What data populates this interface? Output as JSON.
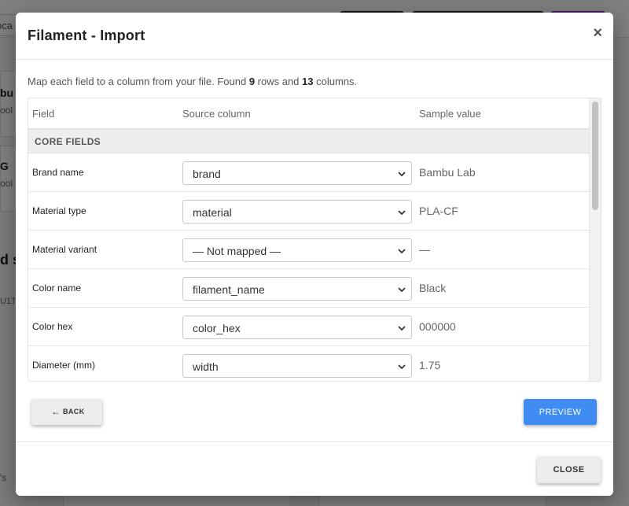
{
  "background": {
    "search_text": "oca",
    "card1_title": "bu",
    "card1_sub": "ool",
    "card2_title": "G",
    "card2_sub": "ool",
    "heading_fragment": "d s",
    "tag_fragment": "U1T",
    "bottom_fragment": "'s"
  },
  "modal": {
    "title": "Filament - Import",
    "close_symbol": "×",
    "intro_prefix": "Map each field to a column from your file. Found ",
    "rows_count": "9",
    "intro_mid": " rows and ",
    "columns_count": "13",
    "intro_suffix": " columns."
  },
  "table": {
    "headers": {
      "field": "Field",
      "source": "Source column",
      "sample": "Sample value"
    },
    "section": "CORE FIELDS",
    "rows": [
      {
        "field": "Brand name",
        "source": "brand",
        "sample": "Bambu Lab"
      },
      {
        "field": "Material type",
        "source": "material",
        "sample": "PLA-CF"
      },
      {
        "field": "Material variant",
        "source": "— Not mapped —",
        "sample": "—"
      },
      {
        "field": "Color name",
        "source": "filament_name",
        "sample": "Black"
      },
      {
        "field": "Color hex",
        "source": "color_hex",
        "sample": "000000"
      },
      {
        "field": "Diameter (mm)",
        "source": "width",
        "sample": "1.75"
      }
    ]
  },
  "buttons": {
    "back_icon": "arrow-left-icon",
    "back": "BACK",
    "preview": "PREVIEW",
    "close": "CLOSE"
  },
  "colors": {
    "primary": "#3f8cf2",
    "overlay": "rgba(0,0,0,0.5)"
  }
}
